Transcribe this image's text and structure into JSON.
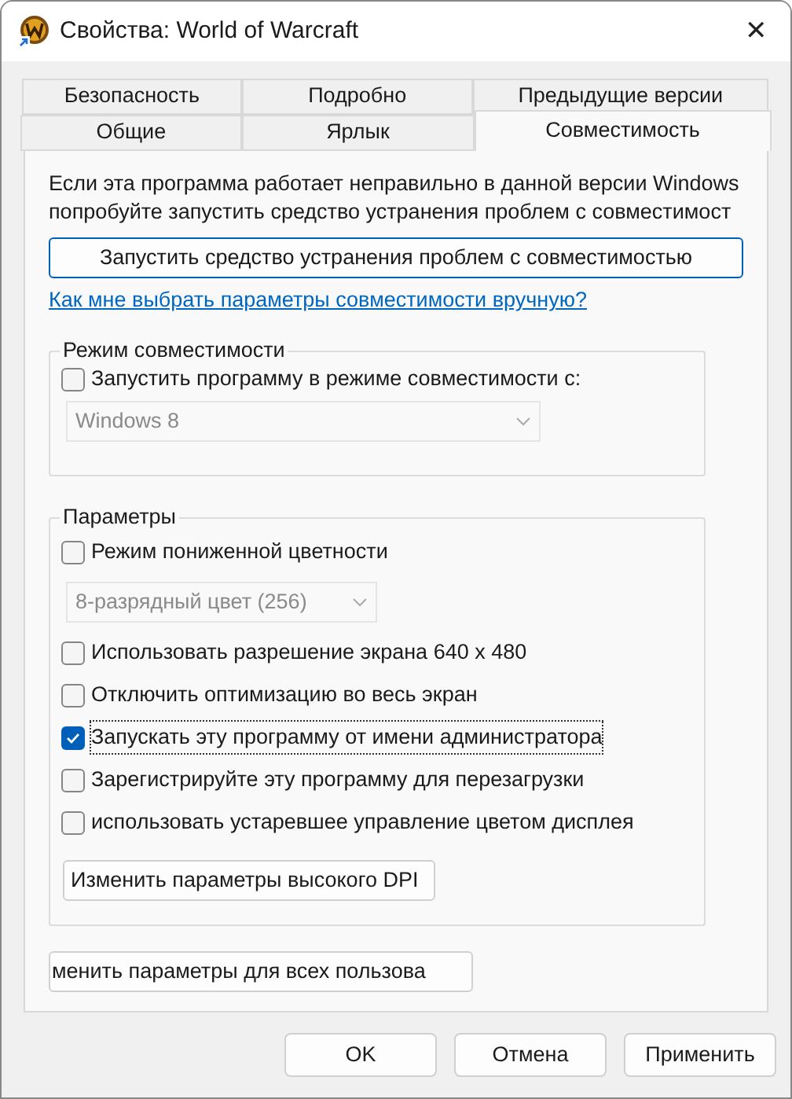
{
  "window": {
    "title": "Свойства: World of Warcraft",
    "close": "✕"
  },
  "tab_rows": [
    [
      {
        "label": "Безопасность",
        "selected": false
      },
      {
        "label": "Подробно",
        "selected": false
      },
      {
        "label": "Предыдущие версии",
        "selected": false
      }
    ],
    [
      {
        "label": "Общие",
        "selected": false
      },
      {
        "label": "Ярлык",
        "selected": false
      },
      {
        "label": "Совместимость",
        "selected": true
      }
    ]
  ],
  "intro_lines": [
    "Если эта программа работает неправильно в данной версии Windows",
    "попробуйте запустить средство устранения проблем с совместимост"
  ],
  "troubleshoot_button": "Запустить средство устранения проблем с совместимостью",
  "help_link": "Как мне выбрать параметры совместимости вручную?",
  "compat_group": {
    "title": "Режим совместимости",
    "items": [
      {
        "kind": "checkbox",
        "label": "Запустить программу в режиме совместимости с:",
        "checked": false
      },
      {
        "kind": "dropdown",
        "value": "Windows 8",
        "disabled": true
      }
    ]
  },
  "params_group": {
    "title": "Параметры",
    "items": [
      {
        "kind": "checkbox",
        "label": "Режим пониженной цветности",
        "checked": false
      },
      {
        "kind": "dropdown",
        "value": "8-разрядный цвет (256)",
        "disabled": true
      },
      {
        "kind": "checkbox",
        "label": "Использовать разрешение экрана 640 x 480",
        "checked": false
      },
      {
        "kind": "checkbox",
        "label": "Отключить оптимизацию во весь экран",
        "checked": false
      },
      {
        "kind": "checkbox",
        "label": "Запускать эту программу от имени администратора",
        "checked": true
      },
      {
        "kind": "checkbox",
        "label": "Зарегистрируйте эту программу для перезагрузки",
        "checked": false
      },
      {
        "kind": "checkbox",
        "label": "использовать устаревшее управление цветом дисплея",
        "checked": false
      },
      {
        "kind": "button",
        "label": "Изменить параметры высокого DPI"
      }
    ]
  },
  "all_users_button": "менить параметры для всех пользова",
  "buttons": [
    {
      "label": "OK"
    },
    {
      "label": "Отмена"
    },
    {
      "label": "Применить"
    }
  ]
}
